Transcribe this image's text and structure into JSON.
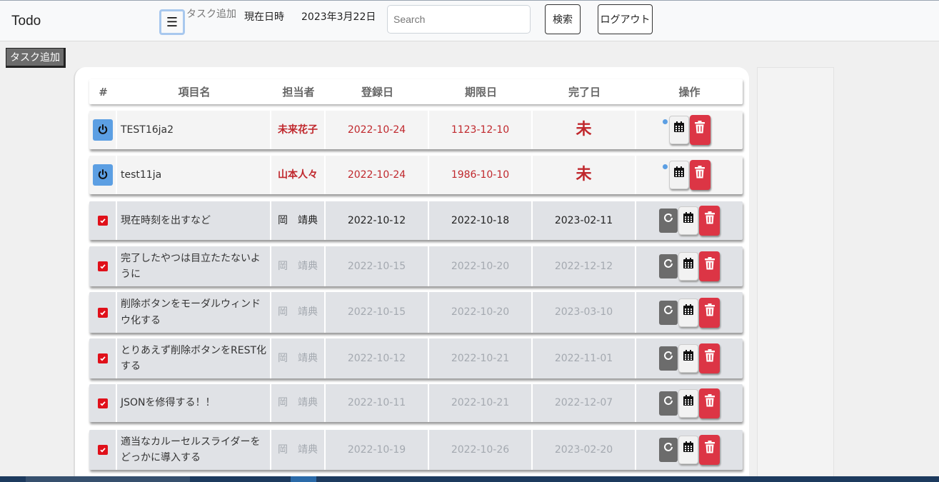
{
  "header": {
    "brand": "Todo",
    "add_task_link": "タスク追加",
    "current_datetime_label": "現在日時",
    "current_date": "2023年3月22日",
    "search_placeholder": "Search",
    "search_button": "検索",
    "logout_button": "ログアウト"
  },
  "sidebar": {
    "add_task_button": "タスク追加"
  },
  "table": {
    "columns": [
      "#",
      "項目名",
      "担当者",
      "登録日",
      "期限日",
      "完了日",
      "操作"
    ],
    "rows": [
      {
        "status": "active",
        "title": "TEST16ja2",
        "assignee": "未来花子",
        "registered": "2022-10-24",
        "due": "1123-12-10",
        "completed": "未"
      },
      {
        "status": "active",
        "title": "test11ja",
        "assignee": "山本人々",
        "registered": "2022-10-24",
        "due": "1986-10-10",
        "completed": "未"
      },
      {
        "status": "done",
        "title": "現在時刻を出すなど",
        "assignee": "岡　靖典",
        "registered": "2022-10-12",
        "due": "2022-10-18",
        "completed": "2023-02-11"
      },
      {
        "status": "done",
        "title": "完了したやつは目立たたないように",
        "assignee": "岡　靖典",
        "registered": "2022-10-15",
        "due": "2022-10-20",
        "completed": "2022-12-12"
      },
      {
        "status": "done",
        "title": "削除ボタンをモーダルウィンドウ化する",
        "assignee": "岡　靖典",
        "registered": "2022-10-15",
        "due": "2022-10-20",
        "completed": "2023-03-10"
      },
      {
        "status": "done",
        "title": "とりあえず削除ボタンをREST化する",
        "assignee": "岡　靖典",
        "registered": "2022-10-12",
        "due": "2022-10-21",
        "completed": "2022-11-01"
      },
      {
        "status": "done",
        "title": "JSONを修得する！！",
        "assignee": "岡　靖典",
        "registered": "2022-10-11",
        "due": "2022-10-21",
        "completed": "2022-12-07"
      },
      {
        "status": "done",
        "title": "適当なカルーセルスライダーをどっかに導入する",
        "assignee": "岡　靖典",
        "registered": "2022-10-19",
        "due": "2022-10-26",
        "completed": "2023-02-20"
      }
    ]
  },
  "icons": {
    "power": "power-icon",
    "checkbox": "checkbox-checked-icon",
    "calendar": "calendar-icon",
    "trash": "trash-icon",
    "redo": "redo-icon",
    "menu": "hamburger-menu-icon"
  },
  "colors": {
    "accent_blue": "#5c9fe3",
    "danger": "#dc3545",
    "overdue_red": "#c0282d",
    "muted_text": "#a4a9b0"
  }
}
